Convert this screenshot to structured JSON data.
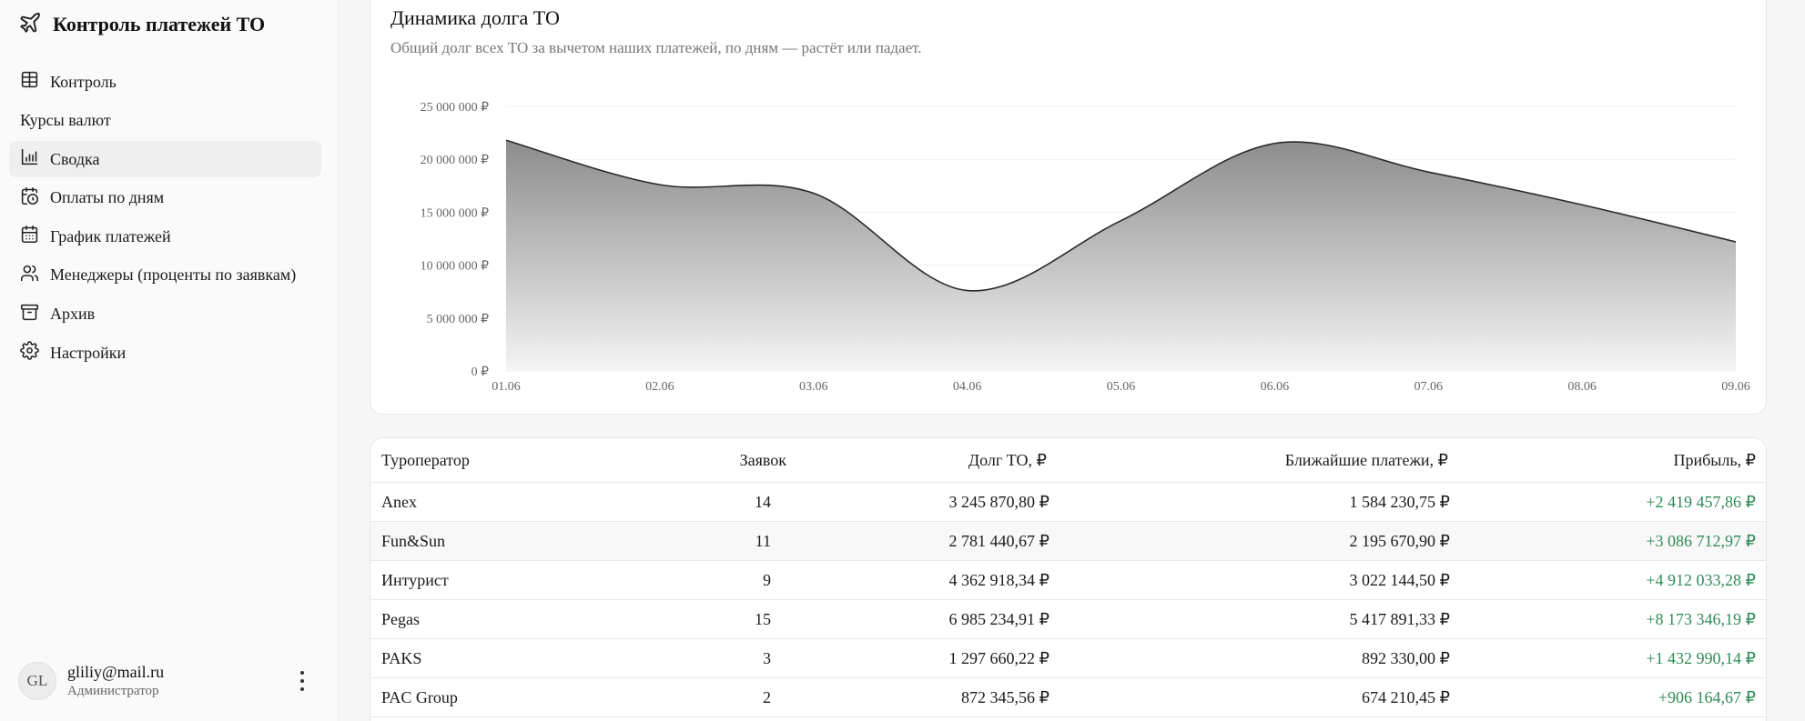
{
  "app": {
    "title": "Контроль платежей ТО"
  },
  "sidebar": {
    "items": [
      {
        "label": "Контроль",
        "icon": "table-icon"
      },
      {
        "label": "Курсы валют",
        "icon": ""
      },
      {
        "label": "Сводка",
        "icon": "bar-chart-icon",
        "active": true
      },
      {
        "label": "Оплаты по дням",
        "icon": "calendar-clock-icon"
      },
      {
        "label": "График платежей",
        "icon": "calendar-icon"
      },
      {
        "label": "Менеджеры (проценты по заявкам)",
        "icon": "users-icon"
      },
      {
        "label": "Архив",
        "icon": "archive-icon"
      },
      {
        "label": "Настройки",
        "icon": "gear-icon"
      }
    ]
  },
  "user": {
    "initials": "GL",
    "email": "gliliy@mail.ru",
    "role": "Администратор"
  },
  "chart": {
    "title": "Динамика долга ТО",
    "subtitle": "Общий долг всех ТО за вычетом наших платежей, по дням — растёт или падает."
  },
  "chart_data": {
    "type": "area",
    "title": "Динамика долга ТО",
    "x": [
      "01.06",
      "02.06",
      "03.06",
      "04.06",
      "05.06",
      "06.06",
      "07.06",
      "08.06",
      "09.06"
    ],
    "y": [
      21800000,
      17600000,
      16800000,
      7600000,
      14200000,
      21500000,
      18800000,
      15700000,
      12200000
    ],
    "ylim": [
      0,
      25000000
    ],
    "yticks": [
      "0 ₽",
      "5 000 000 ₽",
      "10 000 000 ₽",
      "15 000 000 ₽",
      "20 000 000 ₽",
      "25 000 000 ₽"
    ],
    "grid": true,
    "colors": {
      "line": "#2a2a2a",
      "fill_top": "#8c8c8c",
      "fill_bottom": "#f4f4f4"
    }
  },
  "table": {
    "headers": [
      "Туроператор",
      "Заявок",
      "Долг ТО, ₽",
      "Ближайшие платежи, ₽",
      "Прибыль, ₽"
    ],
    "rows": [
      {
        "operator": "Anex",
        "count": "14",
        "debt": "3 245 870,80 ₽",
        "payments": "1 584 230,75 ₽",
        "profit": "+2 419 457,86 ₽"
      },
      {
        "operator": "Fun&Sun",
        "count": "11",
        "debt": "2 781 440,67 ₽",
        "payments": "2 195 670,90 ₽",
        "profit": "+3 086 712,97 ₽"
      },
      {
        "operator": "Интурист",
        "count": "9",
        "debt": "4 362 918,34 ₽",
        "payments": "3 022 144,50 ₽",
        "profit": "+4 912 033,28 ₽"
      },
      {
        "operator": "Pegas",
        "count": "15",
        "debt": "6 985 234,91 ₽",
        "payments": "5 417 891,33 ₽",
        "profit": "+8 173 346,19 ₽"
      },
      {
        "operator": "PAKS",
        "count": "3",
        "debt": "1 297 660,22 ₽",
        "payments": "892 330,00 ₽",
        "profit": "+1 432 990,14 ₽"
      },
      {
        "operator": "PAC Group",
        "count": "2",
        "debt": "872 345,56 ₽",
        "payments": "674 210,45 ₽",
        "profit": "+906 164,67 ₽"
      }
    ],
    "profit_color": "#2e8b57"
  }
}
